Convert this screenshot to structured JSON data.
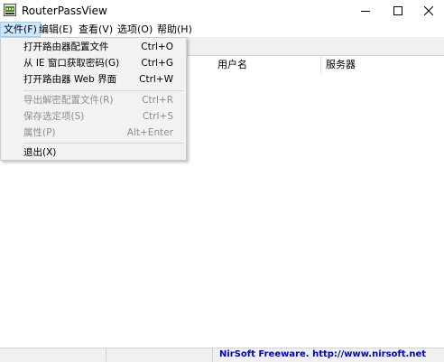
{
  "window": {
    "title": "RouterPassView"
  },
  "menubar": {
    "file": "文件(F)",
    "edit": "编辑(E)",
    "view": "查看(V)",
    "options": "选项(O)",
    "help": "帮助(H)"
  },
  "columns": {
    "user": "用户名",
    "server": "服务器"
  },
  "file_menu": {
    "items": [
      {
        "label": "打开路由器配置文件",
        "shortcut": "Ctrl+O",
        "enabled": true
      },
      {
        "label": "从 IE 窗口获取密码(G)",
        "shortcut": "Ctrl+G",
        "enabled": true
      },
      {
        "label": "打开路由器 Web 界面",
        "shortcut": "Ctrl+W",
        "enabled": true
      },
      {
        "label": "导出解密配置文件(R)",
        "shortcut": "Ctrl+R",
        "enabled": false
      },
      {
        "label": "保存选定项(S)",
        "shortcut": "Ctrl+S",
        "enabled": false
      },
      {
        "label": "属性(P)",
        "shortcut": "Alt+Enter",
        "enabled": false
      },
      {
        "label": "退出(X)",
        "shortcut": "",
        "enabled": true
      }
    ]
  },
  "statusbar": {
    "link": "NirSoft Freeware.  http://www.nirsoft.net"
  },
  "icons": {
    "app": "router-key-icon",
    "minimize": "minimize-icon",
    "maximize": "maximize-icon",
    "close": "close-icon"
  },
  "colors": {
    "link": "#0000cc",
    "menu_active": "#cce8ff"
  }
}
